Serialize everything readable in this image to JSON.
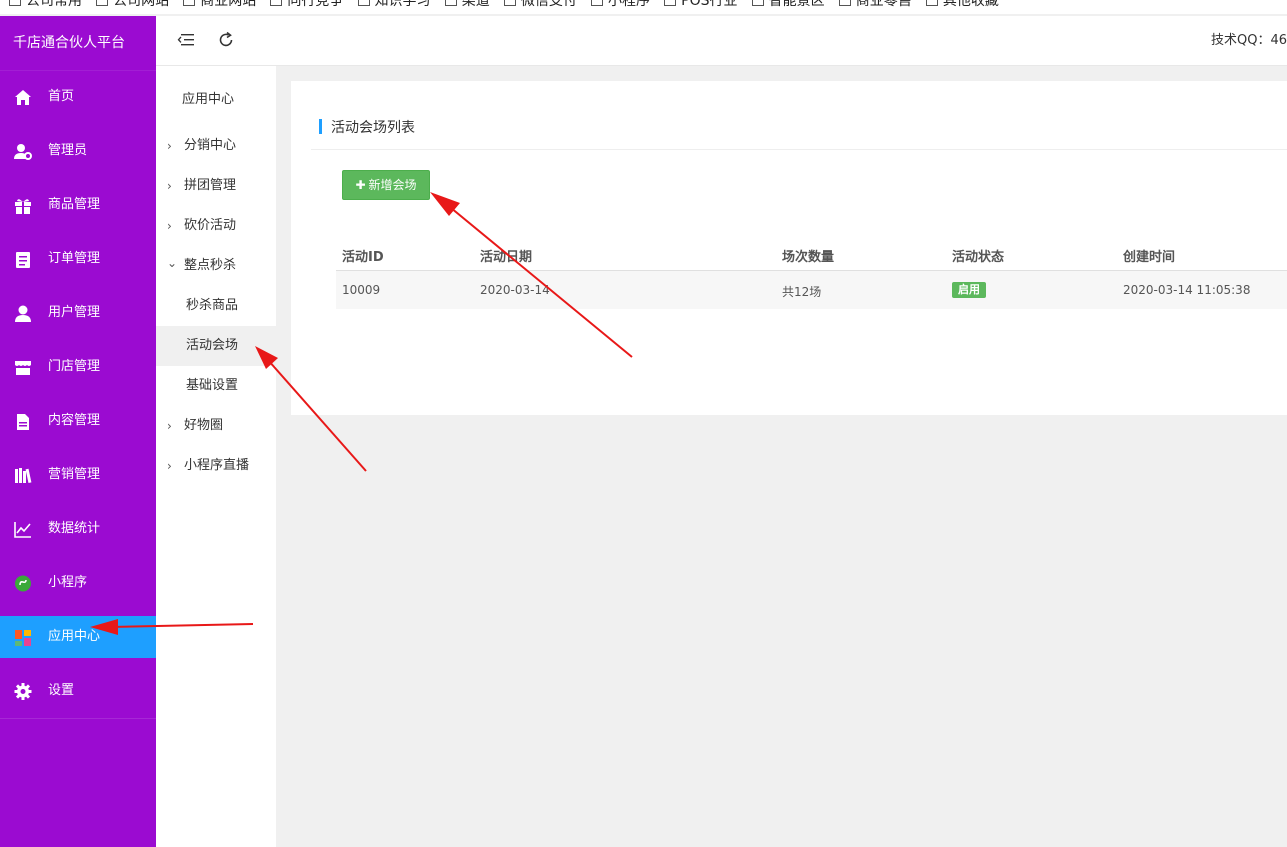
{
  "bookmarks": [
    "公司常用",
    "公司网站",
    "商业网站",
    "同行竞争",
    "知识学习",
    "渠道",
    "微信支付",
    "小程序",
    "POS行业",
    "智能景区",
    "商业零售",
    "其他收藏"
  ],
  "brand": "千店通合伙人平台",
  "nav": [
    {
      "label": "首页",
      "icon": "home-icon"
    },
    {
      "label": "管理员",
      "icon": "admin-icon"
    },
    {
      "label": "商品管理",
      "icon": "gift-icon"
    },
    {
      "label": "订单管理",
      "icon": "clipboard-icon"
    },
    {
      "label": "用户管理",
      "icon": "user-icon"
    },
    {
      "label": "门店管理",
      "icon": "store-icon"
    },
    {
      "label": "内容管理",
      "icon": "document-icon"
    },
    {
      "label": "营销管理",
      "icon": "books-icon"
    },
    {
      "label": "数据统计",
      "icon": "line-chart-icon"
    },
    {
      "label": "小程序",
      "icon": "mini-program-icon"
    },
    {
      "label": "应用中心",
      "icon": "apps-icon"
    },
    {
      "label": "设置",
      "icon": "gear-icon"
    }
  ],
  "active_nav": "应用中心",
  "header": {
    "tech_qq": "技术QQ：46"
  },
  "submenu": {
    "title": "应用中心",
    "items": [
      {
        "label": "分销中心",
        "chevron": "›"
      },
      {
        "label": "拼团管理",
        "chevron": "›"
      },
      {
        "label": "砍价活动",
        "chevron": "›"
      },
      {
        "label": "整点秒杀",
        "chevron": "⌄"
      },
      {
        "label": "秒杀商品",
        "child": true
      },
      {
        "label": "活动会场",
        "child": true,
        "active": true
      },
      {
        "label": "基础设置",
        "child": true
      },
      {
        "label": "好物圈",
        "chevron": "›"
      },
      {
        "label": "小程序直播",
        "chevron": "›"
      }
    ]
  },
  "main": {
    "title": "活动会场列表",
    "add_button": "新增会场",
    "columns": [
      "活动ID",
      "活动日期",
      "场次数量",
      "活动状态",
      "创建时间"
    ],
    "rows": [
      {
        "id": "10009",
        "date": "2020-03-14",
        "count": "共12场",
        "status": "启用",
        "created": "2020-03-14 11:05:38"
      }
    ]
  },
  "colors": {
    "sidebar": "#9b0bd1",
    "active": "#1e9fff",
    "success": "#5cb85c",
    "arrow": "#e81818"
  }
}
